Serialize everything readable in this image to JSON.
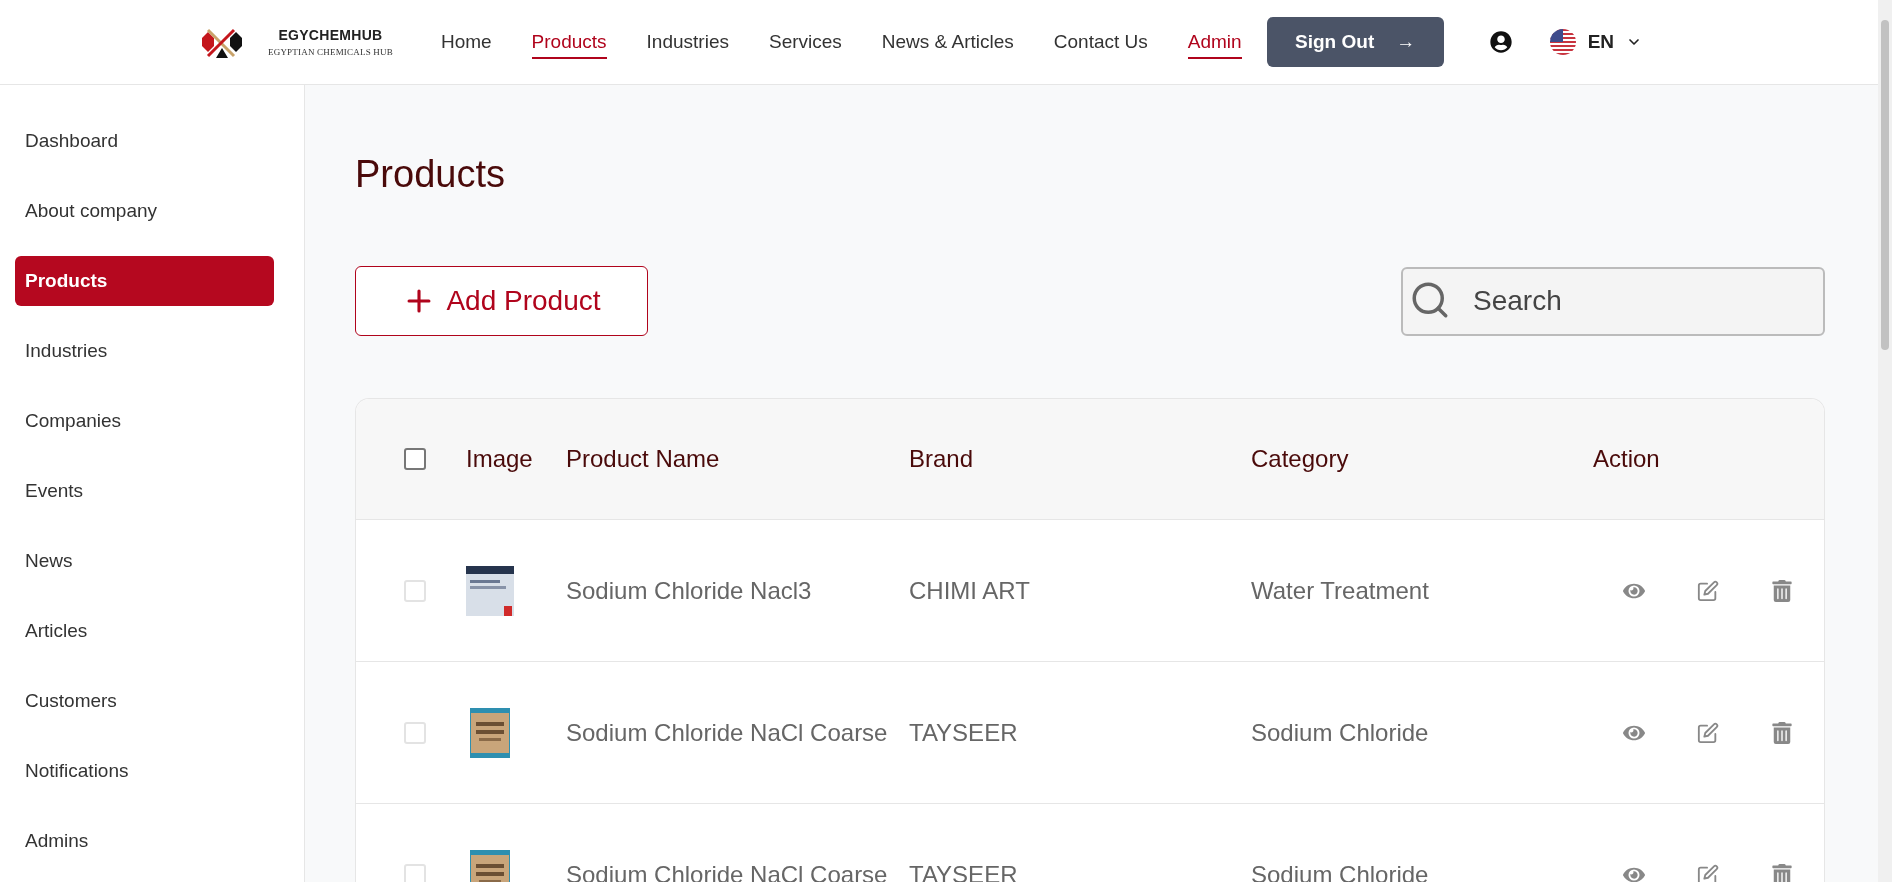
{
  "header": {
    "logo": {
      "title": "EGYCHEMHUB",
      "subtitle": "EGYPTIAN CHEMICALS HUB"
    },
    "nav": [
      {
        "label": "Home",
        "selected": false
      },
      {
        "label": "Products",
        "selected": true
      },
      {
        "label": "Industries",
        "selected": false
      },
      {
        "label": "Services",
        "selected": false
      },
      {
        "label": "News & Articles",
        "selected": false
      },
      {
        "label": "Contact Us",
        "selected": false
      },
      {
        "label": "Admin",
        "selected": true
      }
    ],
    "sign_out": {
      "label": "Sign Out",
      "arrow": "→"
    },
    "language": "EN"
  },
  "sidebar": {
    "items": [
      {
        "label": "Dashboard",
        "selected": false
      },
      {
        "label": "About company",
        "selected": false
      },
      {
        "label": "Products",
        "selected": true
      },
      {
        "label": "Industries",
        "selected": false
      },
      {
        "label": "Companies",
        "selected": false
      },
      {
        "label": "Events",
        "selected": false
      },
      {
        "label": "News",
        "selected": false
      },
      {
        "label": "Articles",
        "selected": false
      },
      {
        "label": "Customers",
        "selected": false
      },
      {
        "label": "Notifications",
        "selected": false
      },
      {
        "label": "Admins",
        "selected": false
      }
    ]
  },
  "page": {
    "title": "Products",
    "add_button": "Add Product",
    "search": {
      "placeholder": "Search"
    }
  },
  "table": {
    "select_all": {
      "checked": false
    },
    "columns": [
      "Image",
      "Product Name",
      "Brand",
      "Category",
      "Action"
    ],
    "rows": [
      {
        "checked": false,
        "name": "Sodium Chloride Nacl3",
        "brand": "CHIMI ART",
        "category": "Water Treatment"
      },
      {
        "checked": false,
        "name": "Sodium Chloride NaCl Coarse",
        "brand": "TAYSEER",
        "category": "Sodium Chloride"
      },
      {
        "checked": false,
        "name": "Sodium Chloride NaCl Coarse",
        "brand": "TAYSEER",
        "category": "Sodium Chloride"
      }
    ]
  }
}
